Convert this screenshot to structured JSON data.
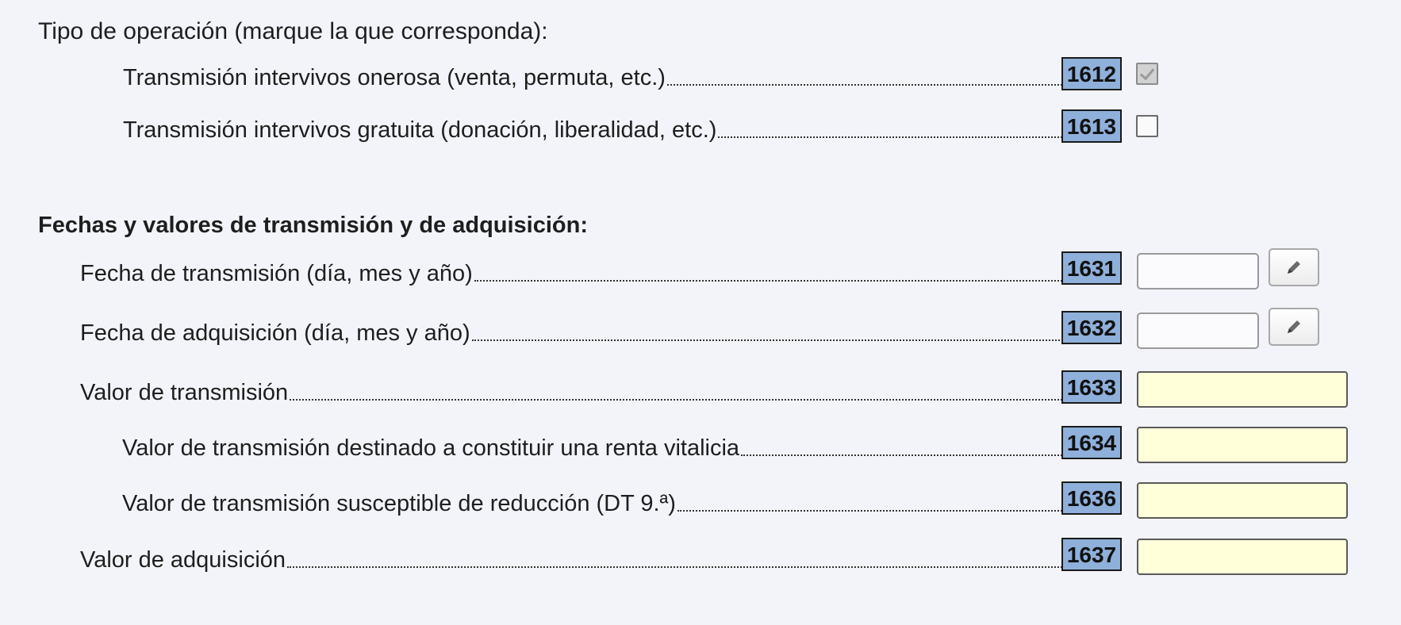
{
  "operacion": {
    "heading": "Tipo de operación (marque la que corresponda):",
    "options": [
      {
        "code": "1612",
        "label": "Transmisión intervivos onerosa (venta, permuta, etc.)",
        "checked": true
      },
      {
        "code": "1613",
        "label": "Transmisión intervivos gratuita (donación, liberalidad, etc.)",
        "checked": false
      }
    ]
  },
  "fechas": {
    "heading": "Fechas y valores de transmisión y de adquisición:",
    "fecha_transmision": {
      "code": "1631",
      "label": "Fecha de transmisión (día, mes y año)",
      "value": ""
    },
    "fecha_adquisicion": {
      "code": "1632",
      "label": "Fecha de adquisición (día, mes y año)",
      "value": ""
    },
    "valor_transmision": {
      "code": "1633",
      "label": "Valor de transmisión",
      "value": ""
    },
    "valor_renta_vitalicia": {
      "code": "1634",
      "label": "Valor de transmisión destinado a constituir una renta vitalicia",
      "value": ""
    },
    "valor_reduccion": {
      "code": "1636",
      "label": "Valor de transmisión susceptible de reducción (DT 9.ª)",
      "value": ""
    },
    "valor_adquisicion": {
      "code": "1637",
      "label": "Valor de adquisición",
      "value": ""
    }
  },
  "icons": {
    "edit": "pencil-icon",
    "check": "checkmark-icon"
  },
  "colors": {
    "background": "#f2f4f9",
    "code_box": "#8eb0da",
    "value_input": "#ffffda"
  }
}
